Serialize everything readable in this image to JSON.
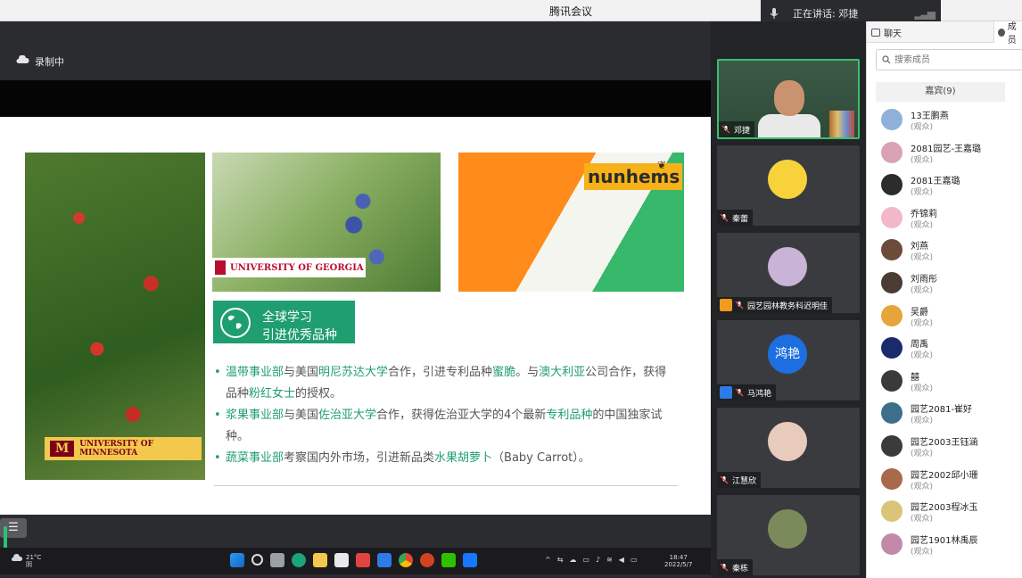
{
  "window": {
    "title": "腾讯会议"
  },
  "speaking": {
    "label": "正在讲话: 邓捷"
  },
  "recording": {
    "label": "录制中"
  },
  "slide": {
    "apple_caption": "UNIVERSITY OF MINNESOTA",
    "uga_caption": "UNIVERSITY OF GEORGIA",
    "nunhems_logo": "nunhems",
    "globe_title_1": "全球学习",
    "globe_title_2": "引进优秀品种",
    "bullets": [
      {
        "parts": [
          {
            "t": "温带事业部",
            "g": true
          },
          {
            "t": "与美国",
            "g": false
          },
          {
            "t": "明尼苏达大学",
            "g": true
          },
          {
            "t": "合作，引进专利品种",
            "g": false
          },
          {
            "t": "蜜脆",
            "g": true
          },
          {
            "t": "。与",
            "g": false
          },
          {
            "t": "澳大利亚",
            "g": true
          },
          {
            "t": "公司合作，获得品种",
            "g": false
          },
          {
            "t": "粉红女士",
            "g": true
          },
          {
            "t": "的授权。",
            "g": false
          }
        ]
      },
      {
        "parts": [
          {
            "t": "浆果事业部",
            "g": true
          },
          {
            "t": "与美国",
            "g": false
          },
          {
            "t": "佐治亚大学",
            "g": true
          },
          {
            "t": "合作，获得佐治亚大学的4个最新",
            "g": false
          },
          {
            "t": "专利品种",
            "g": true
          },
          {
            "t": "的中国独家试种。",
            "g": false
          }
        ]
      },
      {
        "parts": [
          {
            "t": "蔬菜事业部",
            "g": true
          },
          {
            "t": "考察国内外市场，引进新品类",
            "g": false
          },
          {
            "t": "水果胡萝卜",
            "g": true
          },
          {
            "t": "（Baby Carrot）。",
            "g": false
          }
        ]
      }
    ]
  },
  "taskbar": {
    "temp": "21°C",
    "weather_word": "阴",
    "time": "18:47",
    "date": "2022/5/7"
  },
  "videos": [
    {
      "name": "邓捷",
      "type": "camera"
    },
    {
      "name": "秦蕾",
      "type": "avatar",
      "color": "#f7d23a"
    },
    {
      "name": "园艺园林教务科迟明佳",
      "type": "avatar",
      "color": "#c9b3d6",
      "host": "orange"
    },
    {
      "name": "马鸿艳",
      "type": "text",
      "avatar_text": "鸿艳",
      "color": "#1d6fe0",
      "host": "blue"
    },
    {
      "name": "江慧欣",
      "type": "avatar",
      "color": "#e8cbbd"
    },
    {
      "name": "秦栋",
      "type": "avatar",
      "color": "#7a8a5a"
    }
  ],
  "panel": {
    "tab_chat": "聊天",
    "tab_members": "成员",
    "search_placeholder": "搜索成员",
    "group_label": "嘉宾(9)",
    "members": [
      {
        "name": "13王鹏燕",
        "role": "(观众)",
        "color": "#8fb1d9"
      },
      {
        "name": "2081园艺-王嘉璐",
        "role": "(观众)",
        "color": "#d9a3b5"
      },
      {
        "name": "2081王嘉璐",
        "role": "(观众)",
        "color": "#2c2c2c"
      },
      {
        "name": "乔锦莉",
        "role": "(观众)",
        "color": "#f2b8c8"
      },
      {
        "name": "刘燕",
        "role": "(观众)",
        "color": "#6b4b3a"
      },
      {
        "name": "刘雨彤",
        "role": "(观众)",
        "color": "#4a3b33"
      },
      {
        "name": "吴爵",
        "role": "(观众)",
        "color": "#e7a43b"
      },
      {
        "name": "周禹",
        "role": "(观众)",
        "color": "#1b2a6b"
      },
      {
        "name": "囍",
        "role": "(观众)",
        "color": "#3a3a3a"
      },
      {
        "name": "园艺2081-崔好",
        "role": "(观众)",
        "color": "#3d6e8a"
      },
      {
        "name": "园艺2003王钰涵",
        "role": "(观众)",
        "color": "#3b3b3b"
      },
      {
        "name": "园艺2002邱小珊",
        "role": "(观众)",
        "color": "#a86a4a"
      },
      {
        "name": "园艺2003程冰玉",
        "role": "(观众)",
        "color": "#d9c47a"
      },
      {
        "name": "园艺1901林禹辰",
        "role": "(观众)",
        "color": "#c28aa8"
      }
    ]
  }
}
